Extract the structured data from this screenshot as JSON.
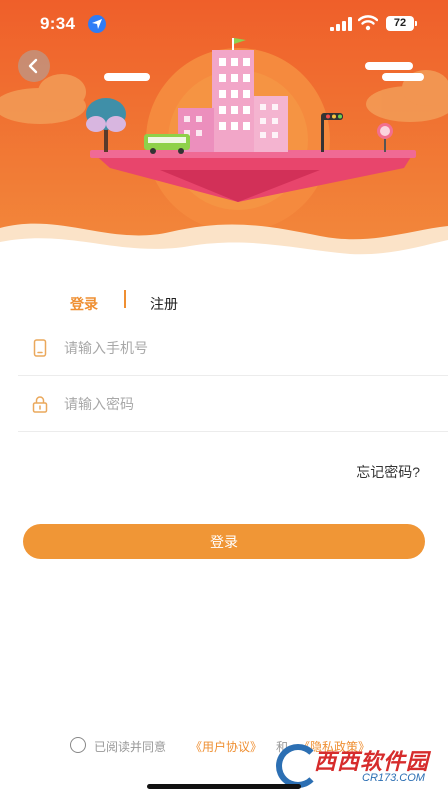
{
  "status_bar": {
    "time": "9:34",
    "battery": "72",
    "icons": [
      "location-arrow-icon",
      "signal-icon",
      "wifi-icon",
      "battery-icon"
    ]
  },
  "header": {
    "back_icon": "chevron-left-icon",
    "illustration": "floating-city-illustration"
  },
  "tabs": [
    {
      "label": "登录",
      "active": true
    },
    {
      "label": "注册",
      "active": false
    }
  ],
  "form": {
    "phone": {
      "placeholder": "请输入手机号",
      "value": "",
      "icon": "phone-icon"
    },
    "password": {
      "placeholder": "请输入密码",
      "value": "",
      "icon": "lock-icon"
    },
    "forgot_label": "忘记密码?",
    "submit_label": "登录"
  },
  "agreement": {
    "checked": false,
    "prefix": "已阅读并同意",
    "user_agreement": "《用户协议》",
    "and": "和",
    "privacy_policy": "《隐私政策》"
  },
  "watermark": {
    "name": "西西软件园",
    "url": "CR173.COM"
  },
  "colors": {
    "accent": "#ef8f32",
    "hero_orange": "#ee6a2c",
    "button": "#f09636"
  }
}
